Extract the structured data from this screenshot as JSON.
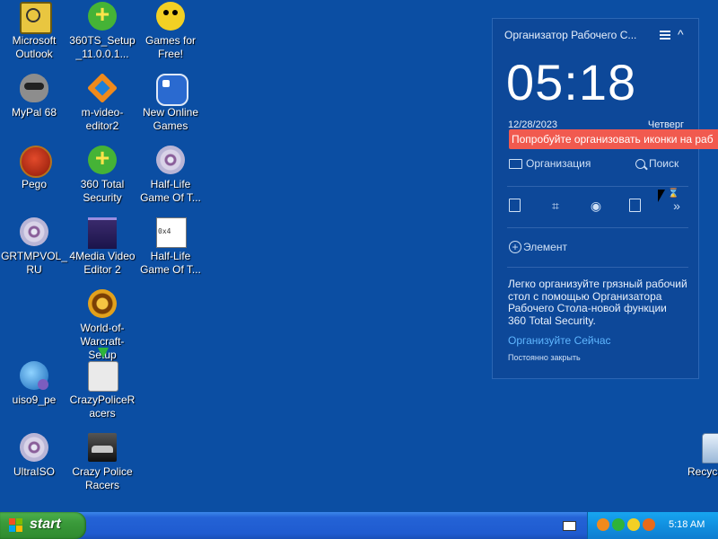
{
  "desktop": {
    "icons": [
      {
        "label": "Microsoft Outlook",
        "icon": "outlook-icon"
      },
      {
        "label": "360TS_Setup_11.0.0.1...",
        "icon": "setup-360-icon"
      },
      {
        "label": "Games for Free!",
        "icon": "games-for-free-icon"
      },
      {
        "label": "MyPal 68",
        "icon": "mypal-icon"
      },
      {
        "label": "m-video-editor2",
        "icon": "video-editor-icon"
      },
      {
        "label": "New Online Games",
        "icon": "gamepad-icon"
      },
      {
        "label": "Pego",
        "icon": "pego-icon"
      },
      {
        "label": "360 Total Security",
        "icon": "security-360-icon"
      },
      {
        "label": "Half-Life Game Of T...",
        "icon": "disc-icon"
      },
      {
        "label": "GRTMPVOL_RU",
        "icon": "disc-icon"
      },
      {
        "label": "4Media Video Editor 2",
        "icon": "media-editor-icon"
      },
      {
        "label": "Half-Life Game Of T...",
        "icon": "file-icon"
      },
      {
        "label": "World-of-Warcraft-Setup",
        "icon": "wow-icon"
      },
      {
        "label": "uiso9_pe",
        "icon": "globe-icon"
      },
      {
        "label": "CrazyPoliceRacers",
        "icon": "installer-icon"
      },
      {
        "label": "UltraISO",
        "icon": "disc-icon"
      },
      {
        "label": "Crazy Police Racers",
        "icon": "car-icon"
      },
      {
        "label": "Recycle Bin",
        "icon": "recycle-bin-icon"
      }
    ]
  },
  "widget": {
    "title": "Организатор Рабочего С...",
    "time": "05:18",
    "date": "12/28/2023",
    "weekday": "Четверг",
    "tip": "Попробуйте организовать иконки на раб",
    "organize_label": "Организация",
    "search_label": "Поиск",
    "add_label": "Элемент",
    "description": "Легко организуйте грязный рабочий стол с помощью Организатора Рабочего Стола-новой функции 360 Total Security.",
    "organize_now": "Организуйте Сейчас",
    "close_forever": "Постоянно закрыть"
  },
  "taskbar": {
    "start_label": "start",
    "clock": "5:18 AM"
  },
  "colors": {
    "desktop": "#0b4ea3",
    "widget_bg": "#0d4899",
    "tip_bg": "#f15a4f",
    "link": "#5fb6ff",
    "start_green": "#3a9a3a"
  }
}
